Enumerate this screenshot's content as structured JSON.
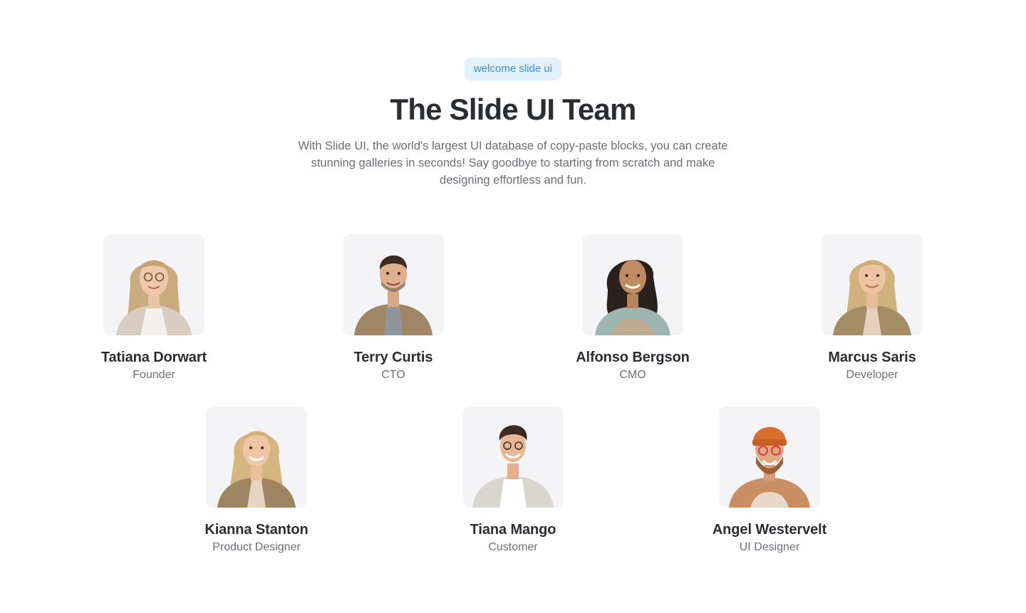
{
  "header": {
    "badge": "welcome slide ui",
    "title": "The Slide UI Team",
    "description": "With Slide UI, the world's largest UI database of copy-paste blocks, you can create stunning galleries in seconds! Say goodbye to starting from scratch and make designing effortless and fun."
  },
  "team": [
    {
      "name": "Tatiana Dorwart",
      "role": "Founder",
      "icon": "avatar-photo"
    },
    {
      "name": "Terry Curtis",
      "role": "CTO",
      "icon": "avatar-photo"
    },
    {
      "name": "Alfonso Bergson",
      "role": "CMO",
      "icon": "avatar-photo"
    },
    {
      "name": "Marcus Saris",
      "role": "Developer",
      "icon": "avatar-photo"
    },
    {
      "name": "Kianna Stanton",
      "role": "Product Designer",
      "icon": "avatar-photo"
    },
    {
      "name": "Tiana Mango",
      "role": "Customer",
      "icon": "avatar-photo"
    },
    {
      "name": "Angel Westervelt",
      "role": "UI Designer",
      "icon": "avatar-photo"
    }
  ],
  "colors": {
    "badge_bg": "#e3f1fc",
    "badge_text": "#3b8fd1",
    "heading": "#2a2d31",
    "muted": "#6a6f75",
    "photo_bg": "#f4f4f6"
  }
}
